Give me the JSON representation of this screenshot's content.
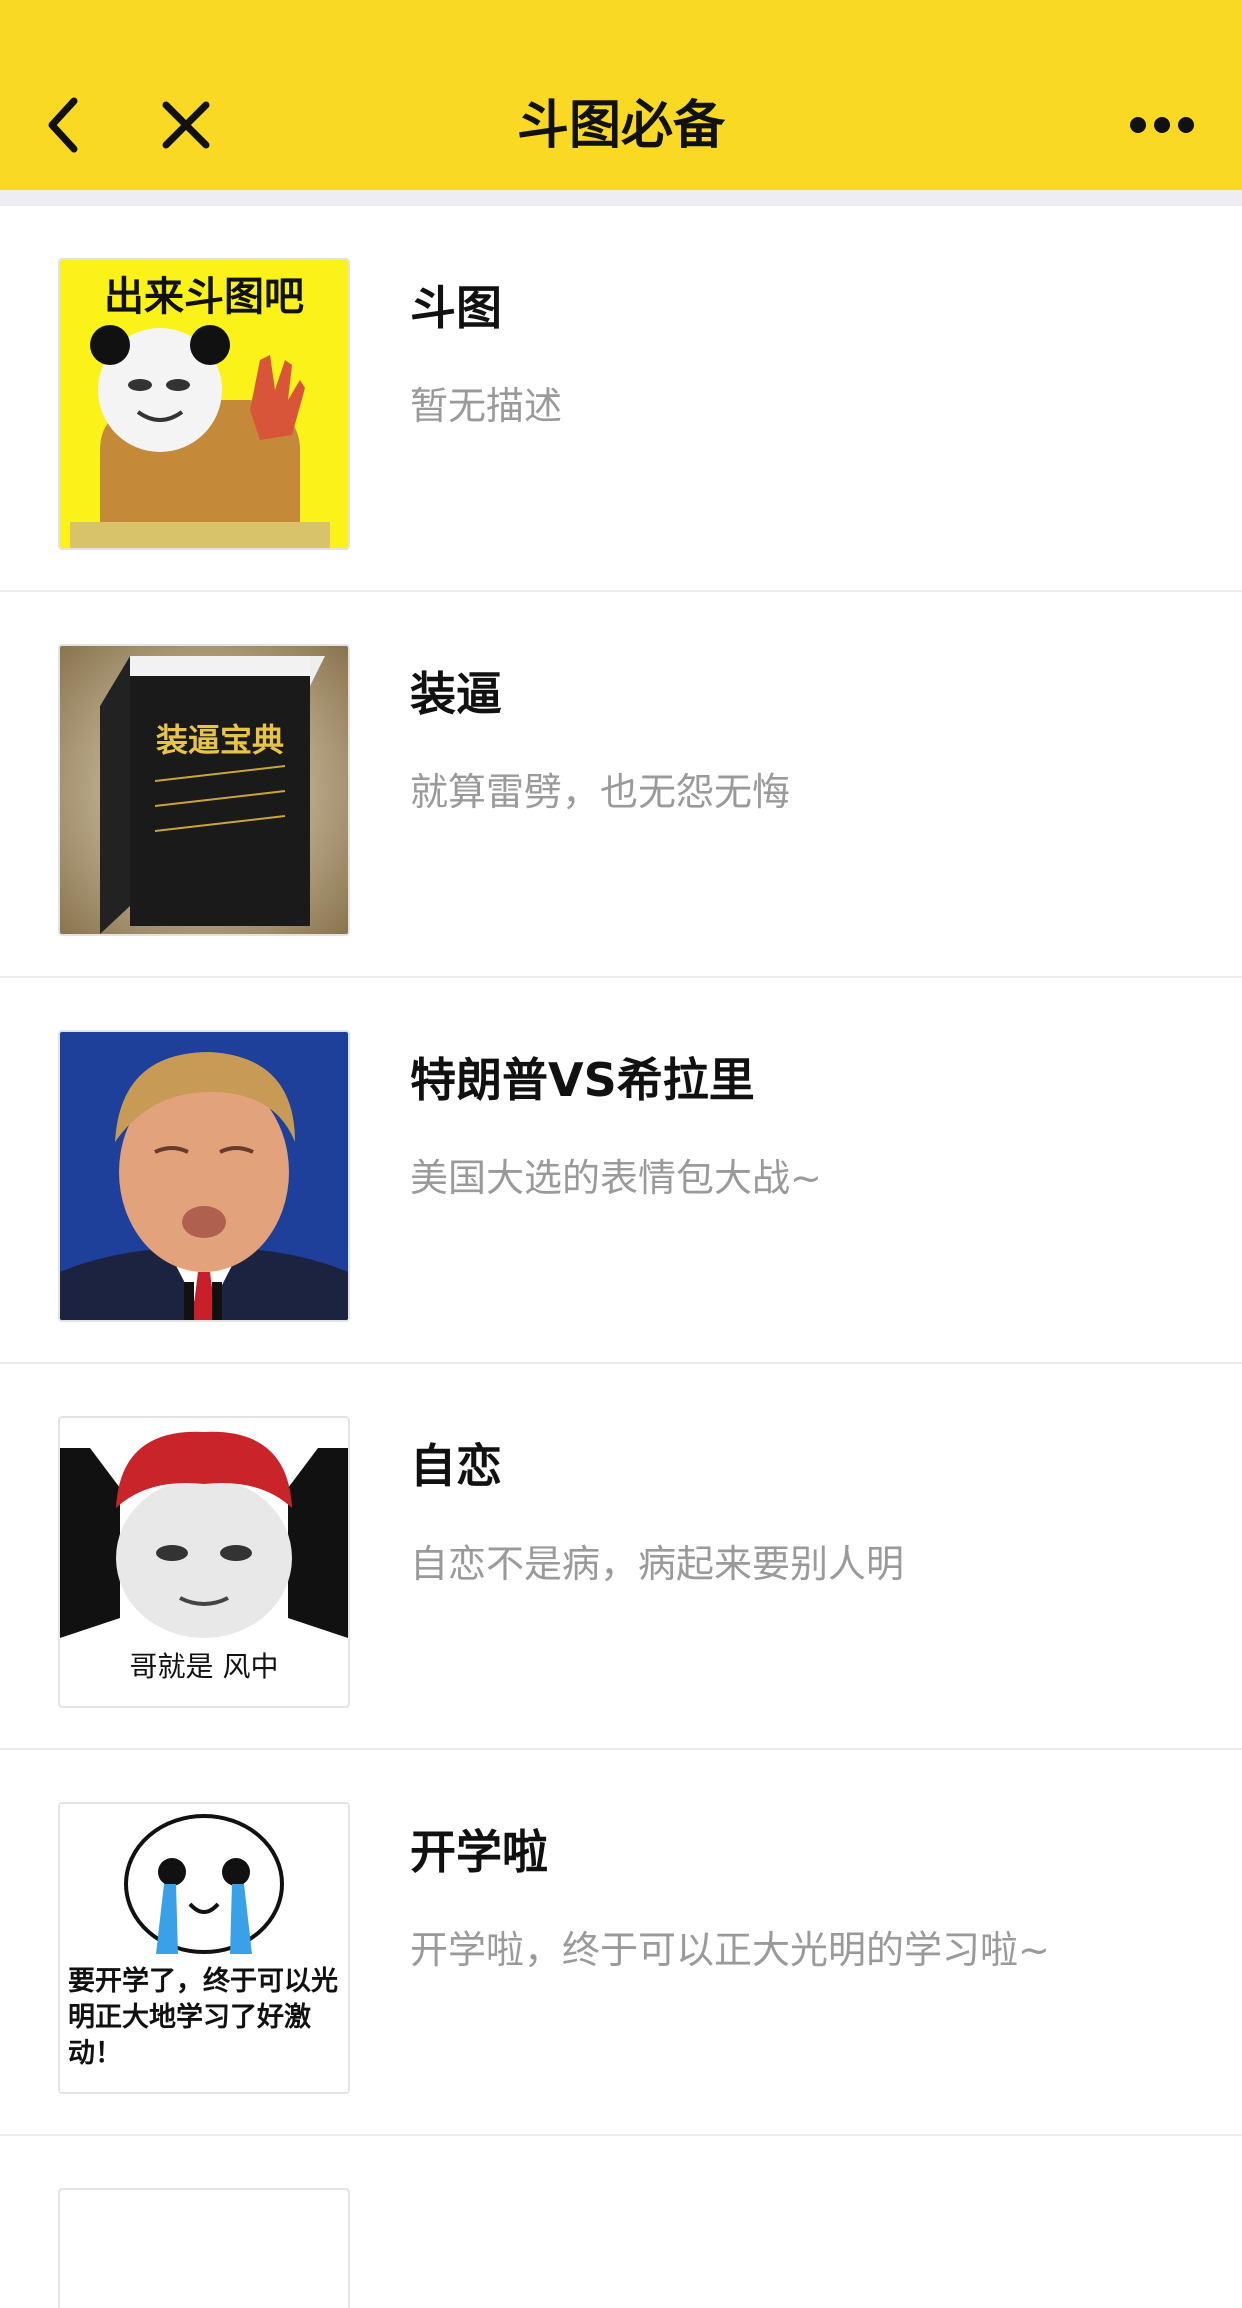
{
  "navbar": {
    "title": "斗图必备",
    "back_icon": "chevron-left-icon",
    "close_icon": "close-icon",
    "more_icon": "more-horizontal-icon",
    "background_color": "#f9d923"
  },
  "list": {
    "items": [
      {
        "title": "斗图",
        "description": "暂无描述",
        "thumbnail": "panda-meme-image",
        "thumbnail_text": "出来斗图吧"
      },
      {
        "title": "装逼",
        "description": "就算雷劈，也无怨无悔",
        "thumbnail": "black-book-image",
        "thumbnail_text": "装逼宝典"
      },
      {
        "title": "特朗普VS希拉里",
        "description": "美国大选的表情包大战~",
        "thumbnail": "trump-face-image"
      },
      {
        "title": "自恋",
        "description": "自恋不是病，病起来要别人明",
        "thumbnail": "narcissist-meme-image",
        "thumbnail_text": "哥就是 风中"
      },
      {
        "title": "开学啦",
        "description": "开学啦，终于可以正大光明的学习啦~",
        "thumbnail": "crying-face-meme-image",
        "thumbnail_text": "要开学了，终于可以光明正大地学习了好激动！"
      }
    ]
  }
}
